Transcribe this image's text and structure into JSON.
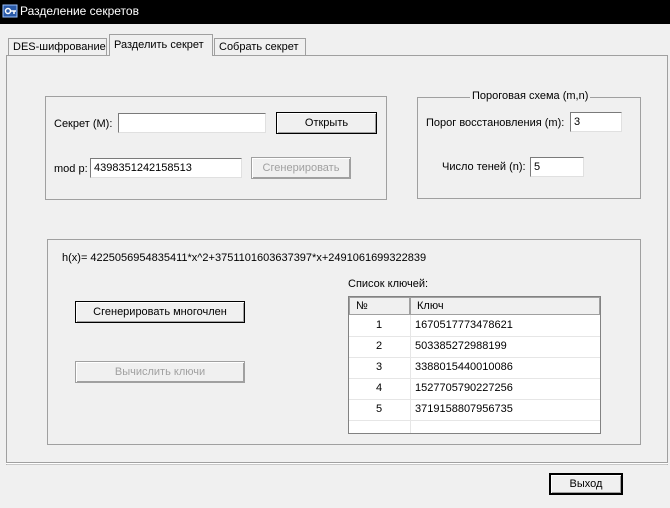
{
  "window": {
    "title": "Разделение секретов"
  },
  "tabs": [
    {
      "label": "DES-шифрование"
    },
    {
      "label": "Разделить секрет",
      "active": true
    },
    {
      "label": "Собрать секрет"
    }
  ],
  "secret_group": {
    "secret_label": "Секрет (M):",
    "secret_value": "",
    "open_button": "Открыть",
    "modp_label": "mod p:",
    "modp_value": "4398351242158513",
    "generate_button": "Сгенерировать"
  },
  "threshold_group": {
    "title": "Пороговая схема (m,n)",
    "m_label": "Порог восстановления (m):",
    "m_value": "3",
    "n_label": "Число теней (n):",
    "n_value": "5"
  },
  "poly_group": {
    "polynomial": "h(x)= 4225056954835411*x^2+3751101603637397*x+2491061699322839",
    "gen_poly_button": "Сгенерировать многочлен",
    "compute_keys_button": "Вычислить ключи",
    "keys_label": "Список ключей:",
    "columns": [
      "№",
      "Ключ"
    ],
    "rows": [
      {
        "num": "1",
        "key": "1670517773478621"
      },
      {
        "num": "2",
        "key": "503385272988199"
      },
      {
        "num": "3",
        "key": "3388015440010086"
      },
      {
        "num": "4",
        "key": "1527705790227256"
      },
      {
        "num": "5",
        "key": "3719158807956735"
      }
    ]
  },
  "footer": {
    "exit_button": "Выход"
  },
  "colors": {
    "titlebar": "#000000",
    "window_bg": "#f0f0f0",
    "disabled_text": "#a0a0a0"
  },
  "icons": {
    "app": "key-icon"
  }
}
